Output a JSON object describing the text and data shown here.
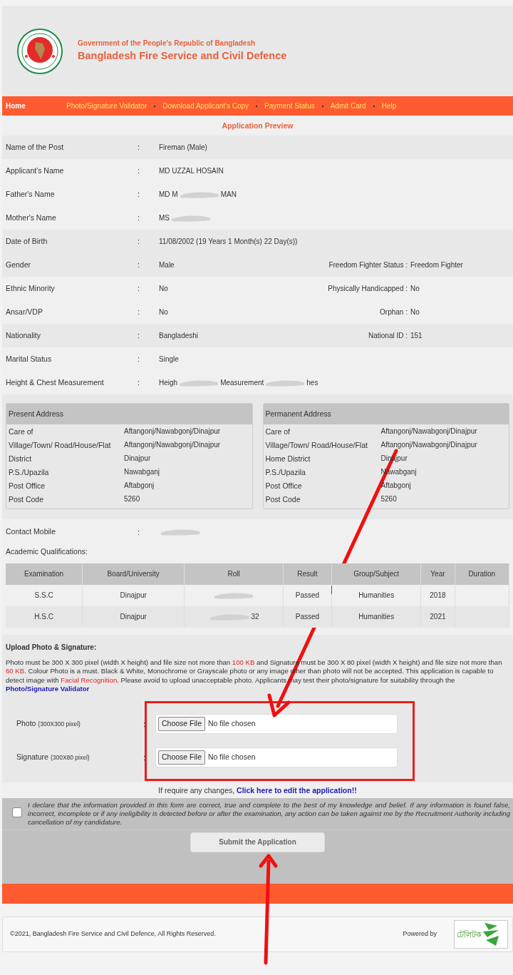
{
  "header": {
    "subtitle": "Government of the People's Republic of Bangladesh",
    "title": "Bangladesh Fire Service and Civil Defence"
  },
  "nav": [
    {
      "label": "Home",
      "selected": true
    },
    {
      "label": "Photo/Signature Validator",
      "selected": false
    },
    {
      "label": "Download Applicant's Copy",
      "selected": false
    },
    {
      "label": "Payment Status",
      "selected": false
    },
    {
      "label": "Admit Card",
      "selected": false
    },
    {
      "label": "Help",
      "selected": false
    }
  ],
  "page_title": "Application Preview",
  "colon": ":",
  "personal_info": [
    [
      {
        "label": "Name of  the Post",
        "fragments": [
          "Fireman (Male)"
        ]
      }
    ],
    [
      {
        "label": "Applicant's Name",
        "fragments": [
          "MD UZZAL HOSAIN"
        ]
      },
      {
        "label": "Father's Name",
        "fragments": [
          "MD M",
          "MAN"
        ]
      },
      {
        "label": "Mother's Name",
        "fragments": [
          "MS"
        ],
        "redacted": true
      }
    ],
    [
      {
        "label": "Date of Birth",
        "fragments": [
          "11/08/2002 (19 Years 1 Month(s) 22 Day(s))"
        ]
      },
      {
        "label": "Gender",
        "fragments": [
          "Male"
        ],
        "right_label": "Freedom Fighter Status :",
        "right_value": "Freedom Fighter"
      }
    ],
    [
      {
        "label": "Ethnic Minority",
        "fragments": [
          "No"
        ],
        "right_label": "Physically Handicapped :",
        "right_value": "No"
      },
      {
        "label": "Ansar/VDP",
        "fragments": [
          "No"
        ],
        "right_label": "Orphan :",
        "right_value": "No"
      }
    ],
    [
      {
        "label": "Nationality",
        "fragments": [
          "Bangladeshi"
        ],
        "right_label": "National ID :",
        "right_value": "151"
      }
    ],
    [
      {
        "label": "Marital Status",
        "fragments": [
          "Single"
        ]
      },
      {
        "label": "Height & Chest Measurement",
        "fragments": [
          "Heigh",
          "Measurement",
          "hes"
        ]
      }
    ]
  ],
  "addresses": [
    {
      "title": "Present Address",
      "rows": [
        {
          "label": "Care of",
          "value": "Aftangonj/Nawabgonj/Dinajpur"
        },
        {
          "label": "Village/Town/ Road/House/Flat",
          "value": "Aftangonj/Nawabgonj/Dinajpur"
        },
        {
          "label": "District",
          "value": "Dinajpur"
        },
        {
          "label": "P.S./Upazila",
          "value": "Nawabganj"
        },
        {
          "label": "Post Office",
          "value": "Aftabgonj"
        },
        {
          "label": "Post Code",
          "value": "5260"
        }
      ]
    },
    {
      "title": "Permanent Address",
      "rows": [
        {
          "label": "Care of",
          "value": "Aftangonj/Nawabgonj/Dinajpur"
        },
        {
          "label": "Village/Town/ Road/House/Flat",
          "value": "Aftangonj/Nawabgonj/Dinajpur"
        },
        {
          "label": "Home District",
          "value": "Dinajpur"
        },
        {
          "label": "P.S./Upazila",
          "value": "Nawabganj"
        },
        {
          "label": "Post Office",
          "value": "Aftabgonj"
        },
        {
          "label": "Post Code",
          "value": "5260"
        }
      ]
    }
  ],
  "contact": {
    "label": "Contact Mobile",
    "redacted": true
  },
  "academic": {
    "title": "Academic Qualifications:",
    "columns": [
      "Examination",
      "Board/University",
      "Roll",
      "Result",
      "Group/Subject",
      "Year",
      "Duration"
    ],
    "rows": [
      {
        "examination": "S.S.C",
        "board": "Dinajpur",
        "roll_redacted": true,
        "result": "Passed",
        "group": "Humanities",
        "year": "2018"
      },
      {
        "examination": "H.S.C",
        "board": "Dinajpur",
        "roll": "32",
        "roll_redacted": true,
        "result": "Passed",
        "group": "Humanities",
        "year": "2021"
      }
    ]
  },
  "upload": {
    "title": "Upload Photo & Signature:",
    "instructions": [
      {
        "kind": "plain",
        "text": "Photo must be 300 X 300 pixel (width X height) and file size not more than "
      },
      {
        "kind": "alert",
        "text": "100 KB"
      },
      {
        "kind": "plain",
        "text": " and Signature must be 300 X 80 pixel (width X height) and file size not more than "
      },
      {
        "kind": "alert",
        "text": "60 KB"
      },
      {
        "kind": "plain",
        "text": ". Colour Photo is a must. Black & White, Monochrome or Grayscale photo or any image other than photo will not be accepted. This application is capable to detect image with "
      },
      {
        "kind": "alert",
        "text": "Facial Recognition"
      },
      {
        "kind": "plain",
        "text": ". Please avoid to upload unacceptable photo. Applicants may test their photo/signature for suitability through the "
      },
      {
        "kind": "link",
        "text": "Photo/Signature Validator"
      }
    ],
    "highlighted": true,
    "fields": [
      {
        "label": "Photo",
        "hint": "(300X300 pixel)",
        "button": "Choose File",
        "status": "No file chosen"
      },
      {
        "label": "Signature",
        "hint": "(300X80 pixel)",
        "button": "Choose File",
        "status": "No file chosen"
      }
    ],
    "edit_prompt": "If require any changes,",
    "edit_link": "Click here to edit the application!!"
  },
  "declaration": {
    "checked": false,
    "text": "I declare that the information provided in this form are correct, true and complete to the best of my knowledge and belief. If any information is found false, incorrect, incomplete or if any ineligibility is detected before or after the examination, any action can be taken against me by the Recruitment Authority including cancellation of my candidature."
  },
  "submit": "Submit the Application",
  "footer": {
    "copyright": "©2021, Bangladesh Fire Service and Civil Defence, All Rights Reserved.",
    "powered_by": "Powered by",
    "logo_text": "টেলিটক"
  }
}
